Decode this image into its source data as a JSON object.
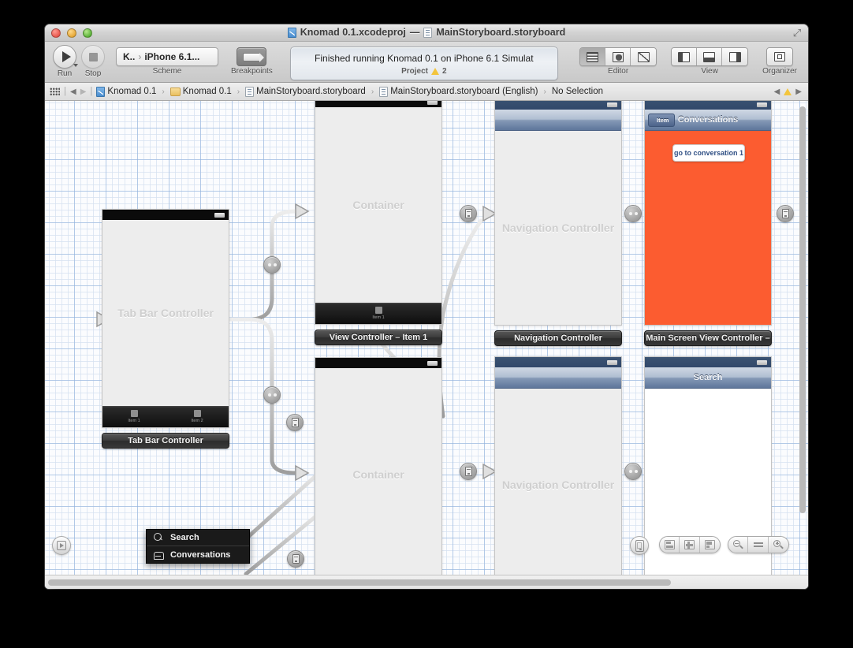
{
  "window": {
    "title": "Knomad 0.1.xcodeproj",
    "title_separator": "—",
    "title_file": "MainStoryboard.storyboard",
    "traffic": {
      "close": "close-button",
      "minimize": "minimize-button",
      "maximize": "maximize-button"
    },
    "fullscreen_glyph": "⤢"
  },
  "toolbar": {
    "run_label": "Run",
    "stop_label": "Stop",
    "scheme_label": "Scheme",
    "scheme_project": "K..",
    "scheme_separator": "›",
    "scheme_destination": "iPhone 6.1...",
    "breakpoints_label": "Breakpoints",
    "editor_label": "Editor",
    "view_label": "View",
    "organizer_label": "Organizer",
    "activity": {
      "status": "Finished running Knomad 0.1 on iPhone 6.1 Simulat",
      "scope": "Project",
      "warning_count": "2"
    }
  },
  "jumpbar": {
    "back_glyph": "◀",
    "forward_glyph": "▶",
    "crumbs": [
      {
        "label": "Knomad 0.1",
        "icon": "project-icon"
      },
      {
        "label": "Knomad 0.1",
        "icon": "folder-icon"
      },
      {
        "label": "MainStoryboard.storyboard",
        "icon": "storyboard-icon"
      },
      {
        "label": "MainStoryboard.storyboard (English)",
        "icon": "storyboard-icon"
      },
      {
        "label": "No Selection",
        "icon": "none"
      }
    ],
    "issue_prev": "◀",
    "issue_next": "▶"
  },
  "canvas": {
    "scenes": [
      {
        "id": "tab-bar-controller",
        "ghost": "Tab Bar Controller",
        "label": "Tab Bar Controller",
        "tab_items": [
          "Item 1",
          "Item 2"
        ]
      },
      {
        "id": "view-controller-item-1",
        "ghost": "Container",
        "label": "View Controller – Item 1",
        "tab_items": [
          "Item 1"
        ]
      },
      {
        "id": "view-controller-item-2",
        "ghost": "Container",
        "label": ""
      },
      {
        "id": "navigation-controller-top",
        "ghost": "Navigation Controller",
        "label": "Navigation Controller"
      },
      {
        "id": "navigation-controller-bottom",
        "ghost": "Navigation Controller",
        "label": ""
      },
      {
        "id": "main-screen-view-controller",
        "nav_title": "Conversations",
        "nav_back": "Item",
        "button": "go to conversation 1",
        "label": "Main Screen View Controller –",
        "background_color": "#fc5c30"
      },
      {
        "id": "search-view-controller",
        "nav_title": "Search",
        "label": ""
      }
    ],
    "popup_menu": {
      "items": [
        {
          "label": "Search",
          "icon": "search-icon"
        },
        {
          "label": "Conversations",
          "icon": "inbox-icon"
        }
      ]
    },
    "bottom_bar": {
      "device_button": "device-orientation-button",
      "align_buttons": [
        "align-button",
        "resize-button",
        "arrange-button"
      ],
      "zoom_out": "zoom-out-button",
      "zoom_actual": "zoom-actual-size-button",
      "zoom_in": "zoom-in-button",
      "animate_button": "animate-button"
    }
  },
  "colors": {
    "orange_scene": "#fc5c30",
    "nav_bar_blue": "#5e769b",
    "ghost_text": "#cfcfcf",
    "warning_yellow": "#f3c53d"
  }
}
